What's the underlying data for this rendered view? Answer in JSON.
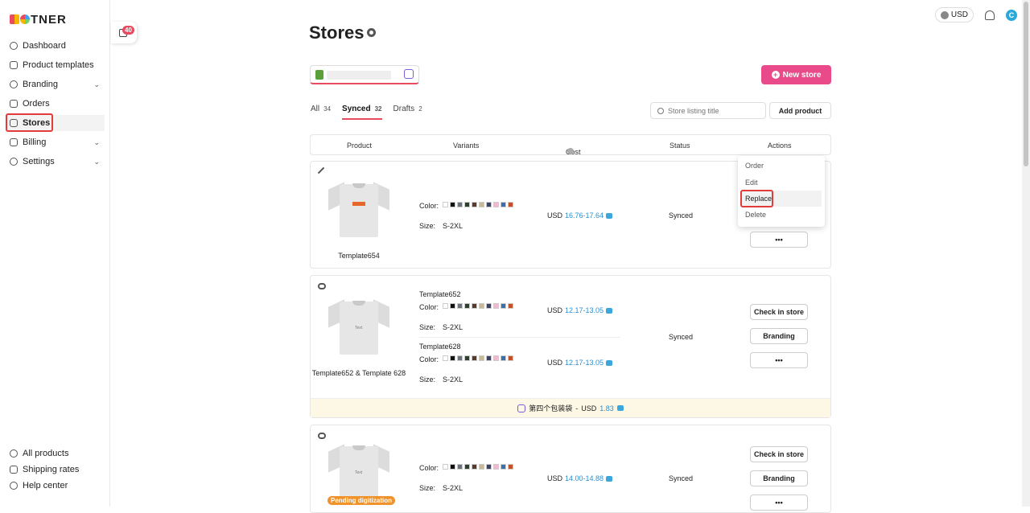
{
  "logo": {
    "text": "TNER"
  },
  "sidebar": {
    "items": [
      {
        "label": "Dashboard"
      },
      {
        "label": "Product templates"
      },
      {
        "label": "Branding"
      },
      {
        "label": "Orders"
      },
      {
        "label": "Stores"
      },
      {
        "label": "Billing"
      },
      {
        "label": "Settings"
      }
    ],
    "bottom": [
      {
        "label": "All products"
      },
      {
        "label": "Shipping rates"
      },
      {
        "label": "Help center"
      }
    ]
  },
  "cart_badge": "40",
  "topbar": {
    "currency": "USD",
    "avatar": "C"
  },
  "page": {
    "title": "Stores"
  },
  "new_store_label": "New store",
  "tabs": [
    {
      "label": "All",
      "count": "34"
    },
    {
      "label": "Synced",
      "count": "32"
    },
    {
      "label": "Drafts",
      "count": "2"
    }
  ],
  "search": {
    "placeholder": "Store listing title"
  },
  "add_product_label": "Add product",
  "table_headers": {
    "product": "Product",
    "variants": "Variants",
    "cost": "Cost",
    "status": "Status",
    "actions": "Actions"
  },
  "colors": {
    "swatches": [
      "#ffffff",
      "#111111",
      "#6b7280",
      "#2f3e2f",
      "#5a3b2b",
      "#c9b99b",
      "#3b4466",
      "#f3b8d1",
      "#3b6fb0",
      "#c2502b"
    ],
    "accent": "#e84a5f",
    "brand_pink": "#e84a8a"
  },
  "labels": {
    "color": "Color:",
    "size": "Size:",
    "currency": "USD"
  },
  "rows": [
    {
      "name": "Template654",
      "size": "S-2XL",
      "cost": "16.76-17.64",
      "status": "Synced",
      "more": "•••"
    },
    {
      "name": "Template652 & Template 628",
      "variants": [
        {
          "title": "Template652",
          "size": "S-2XL",
          "cost": "12.17-13.05"
        },
        {
          "title": "Template628",
          "size": "S-2XL",
          "cost": "12.17-13.05"
        }
      ],
      "status": "Synced",
      "check_label": "Check in store",
      "branding_label": "Branding",
      "more": "•••",
      "packaging": {
        "name": "第四个包装袋",
        "currency": "USD",
        "value": "1.83"
      }
    },
    {
      "name": "",
      "size": "S-2XL",
      "cost": "14.00-14.88",
      "status": "Synced",
      "check_label": "Check in store",
      "branding_label": "Branding",
      "more": "•••",
      "pending": "Pending digitization"
    }
  ],
  "dropdown": {
    "items": [
      "Order",
      "Edit",
      "Replace",
      "Delete"
    ]
  }
}
